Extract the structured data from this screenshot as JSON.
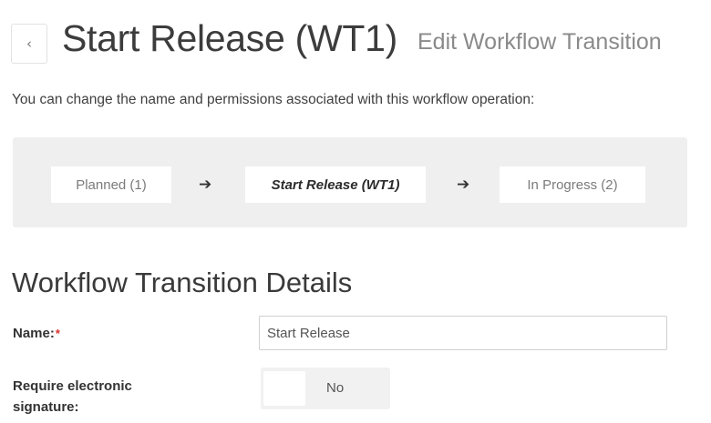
{
  "header": {
    "back_icon": "chevron-left-icon",
    "back_glyph": "‹",
    "title": "Start Release (WT1)",
    "subtitle": "Edit Workflow Transition"
  },
  "description": "You can change the name and permissions associated with this workflow operation:",
  "flow": {
    "from_state": "Planned (1)",
    "transition": "Start Release (WT1)",
    "to_state": "In Progress (2)",
    "arrow_icon": "arrow-right-icon",
    "arrow_glyph": "➔"
  },
  "details": {
    "section_title": "Workflow Transition Details",
    "name_label": "Name:",
    "required_mark": "*",
    "name_value": "Start Release",
    "esig_label_line1": "Require electronic",
    "esig_label_line2": "signature:",
    "esig_value": "No"
  },
  "colors": {
    "required": "#d9302a",
    "panel_bg": "#efefef"
  }
}
